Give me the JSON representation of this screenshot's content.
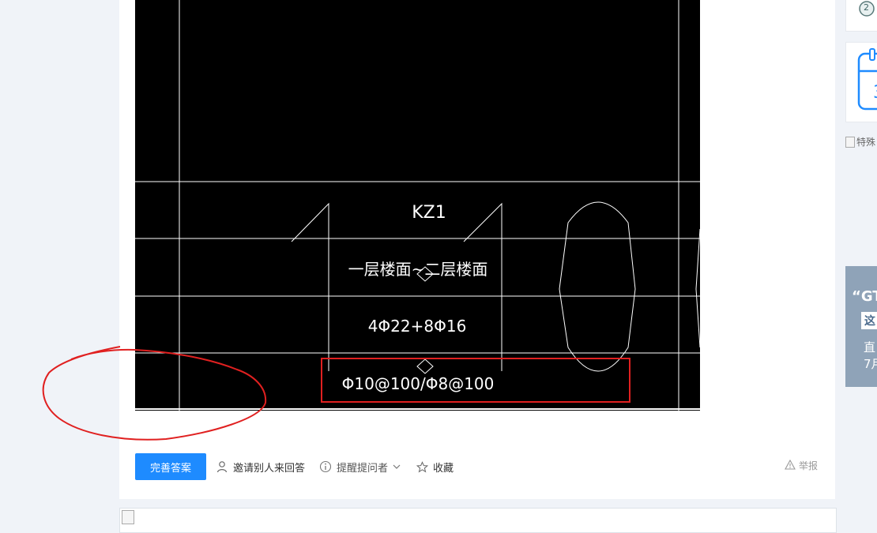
{
  "drawing": {
    "column_id": "KZ1",
    "floor_range": "一层楼面~二层楼面",
    "longitudinal_rebar": "4Φ22+8Φ16",
    "stirrups": "Φ10@100/Φ8@100"
  },
  "actions": {
    "complete_answer": "完善答案",
    "invite": "邀请别人来回答",
    "remind": "提醒提问者",
    "favorite": "收藏",
    "report": "举报"
  },
  "sidebar": {
    "badge_number": "2",
    "broken_image_alt": "特殊",
    "banner_quote": "“GT",
    "banner_highlight": "这",
    "banner_line1": "直",
    "banner_line2": "7月"
  },
  "colors": {
    "primary": "#1e8bff",
    "annotation_red": "#e02020",
    "cad_background": "#000000"
  },
  "icons": [
    "user-icon",
    "info-icon",
    "chevron-down-icon",
    "star-icon",
    "warning-icon",
    "calendar-icon"
  ]
}
